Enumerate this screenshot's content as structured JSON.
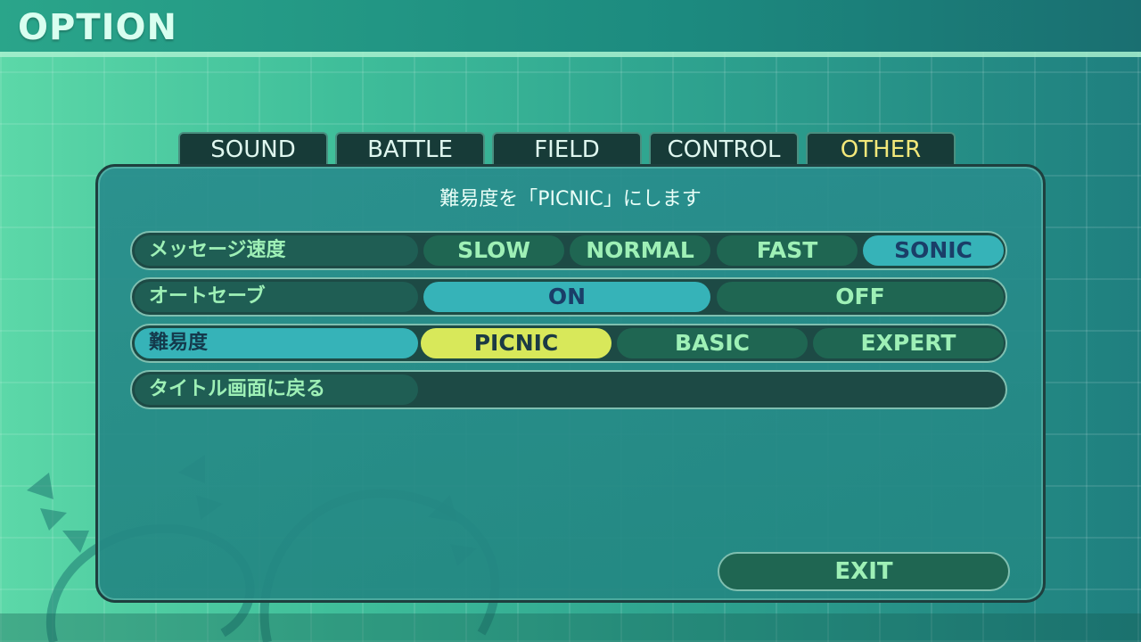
{
  "header": {
    "title": "OPTION"
  },
  "tabs": [
    {
      "label": "SOUND",
      "active": false
    },
    {
      "label": "BATTLE",
      "active": false
    },
    {
      "label": "FIELD",
      "active": false
    },
    {
      "label": "CONTROL",
      "active": false
    },
    {
      "label": "OTHER",
      "active": true
    }
  ],
  "panel": {
    "message": "難易度を「PICNIC」にします",
    "rows": [
      {
        "label": "メッセージ速度",
        "options": [
          "SLOW",
          "NORMAL",
          "FAST",
          "SONIC"
        ],
        "selected": "SONIC"
      },
      {
        "label": "オートセーブ",
        "options": [
          "ON",
          "OFF"
        ],
        "selected": "ON"
      },
      {
        "label": "難易度",
        "options": [
          "PICNIC",
          "BASIC",
          "EXPERT"
        ],
        "selected": "PICNIC"
      },
      {
        "label": "タイトル画面に戻る"
      }
    ],
    "exit_label": "EXIT"
  },
  "colors": {
    "accent": "#36b3b8",
    "highlight": "#d8e85a",
    "active_tab_text": "#f2e87a"
  }
}
